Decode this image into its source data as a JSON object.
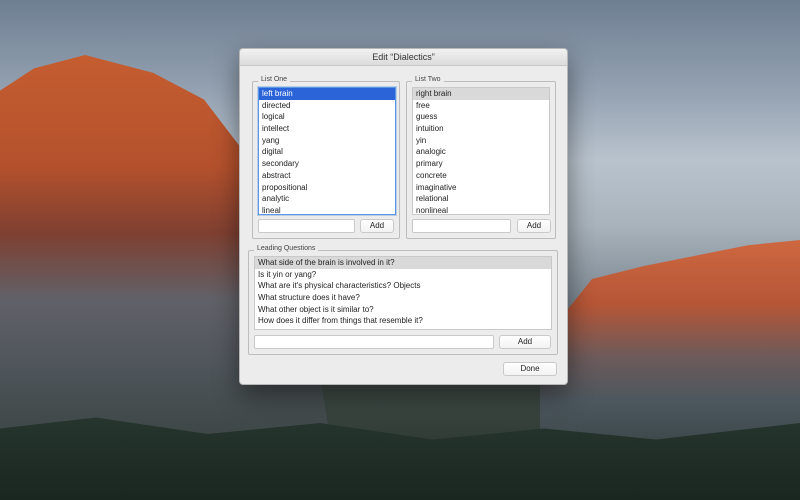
{
  "window": {
    "title": "Edit “Dialectics”"
  },
  "list_one": {
    "label": "List One",
    "items": [
      "left brain",
      "directed",
      "logical",
      "intellect",
      "yang",
      "digital",
      "secondary",
      "abstract",
      "propositional",
      "analytic",
      "lineal"
    ],
    "selected_index": 0,
    "add_label": "Add",
    "input_value": ""
  },
  "list_two": {
    "label": "List Two",
    "items": [
      "right brain",
      "free",
      "guess",
      "intuition",
      "yin",
      "analogic",
      "primary",
      "concrete",
      "imaginative",
      "relational",
      "nonlineal"
    ],
    "selected_index": 0,
    "add_label": "Add",
    "input_value": ""
  },
  "leading_questions": {
    "label": "Leading Questions",
    "items": [
      "What side of the brain is involved in it?",
      "Is it yin or yang?",
      "What are it's physical characteristics? Objects",
      "What structure does it have?",
      "What other object is it similar to?",
      "How does it differ from things that resemble it?"
    ],
    "selected_index": 0,
    "add_label": "Add",
    "input_value": ""
  },
  "footer": {
    "done_label": "Done"
  },
  "colors": {
    "selection_blue": "#2b63d9",
    "selection_gray": "#d9d9d9",
    "focus_ring": "#5b96e3"
  }
}
